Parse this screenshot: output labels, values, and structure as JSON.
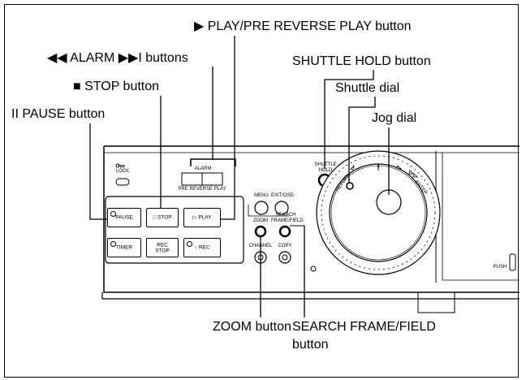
{
  "callouts": {
    "play": "▶ PLAY/PRE REVERSE PLAY button",
    "alarm": "◀◀ ALARM ▶▶I buttons",
    "shuttle_hold": "SHUTTLE HOLD button",
    "stop": "■ STOP button",
    "shuttle_dial": "Shuttle dial",
    "pause": "II PAUSE button",
    "jog_dial": "Jog dial",
    "zoom": "ZOOM button",
    "search_line1": "SEARCH FRAME/FIELD",
    "search_line2": "button"
  },
  "panel": {
    "lock": "LOCK",
    "alarm": "ALARM",
    "pre_reverse_play": "PRE REVERSE PLAY",
    "pause": "PAUSE",
    "stop": "□ STOP",
    "play": "▷ PLAY",
    "timer": "TIMER",
    "rec_stop_1": "REC",
    "rec_stop_2": "STOP",
    "rec": "○ REC",
    "menu": "MENU",
    "exit_osd": "EXIT/OSD",
    "zoom": "ZOOM",
    "search_1": "SEARCH",
    "search_2": "FRAME/FIELD",
    "channel": "CHANNEL",
    "copy": "COPY",
    "shuttle_hold_1": "SHUTTLE",
    "shuttle_hold_2": "HOLD",
    "return": "RETURN",
    "enter": "ENTER",
    "push": "PUSH"
  }
}
